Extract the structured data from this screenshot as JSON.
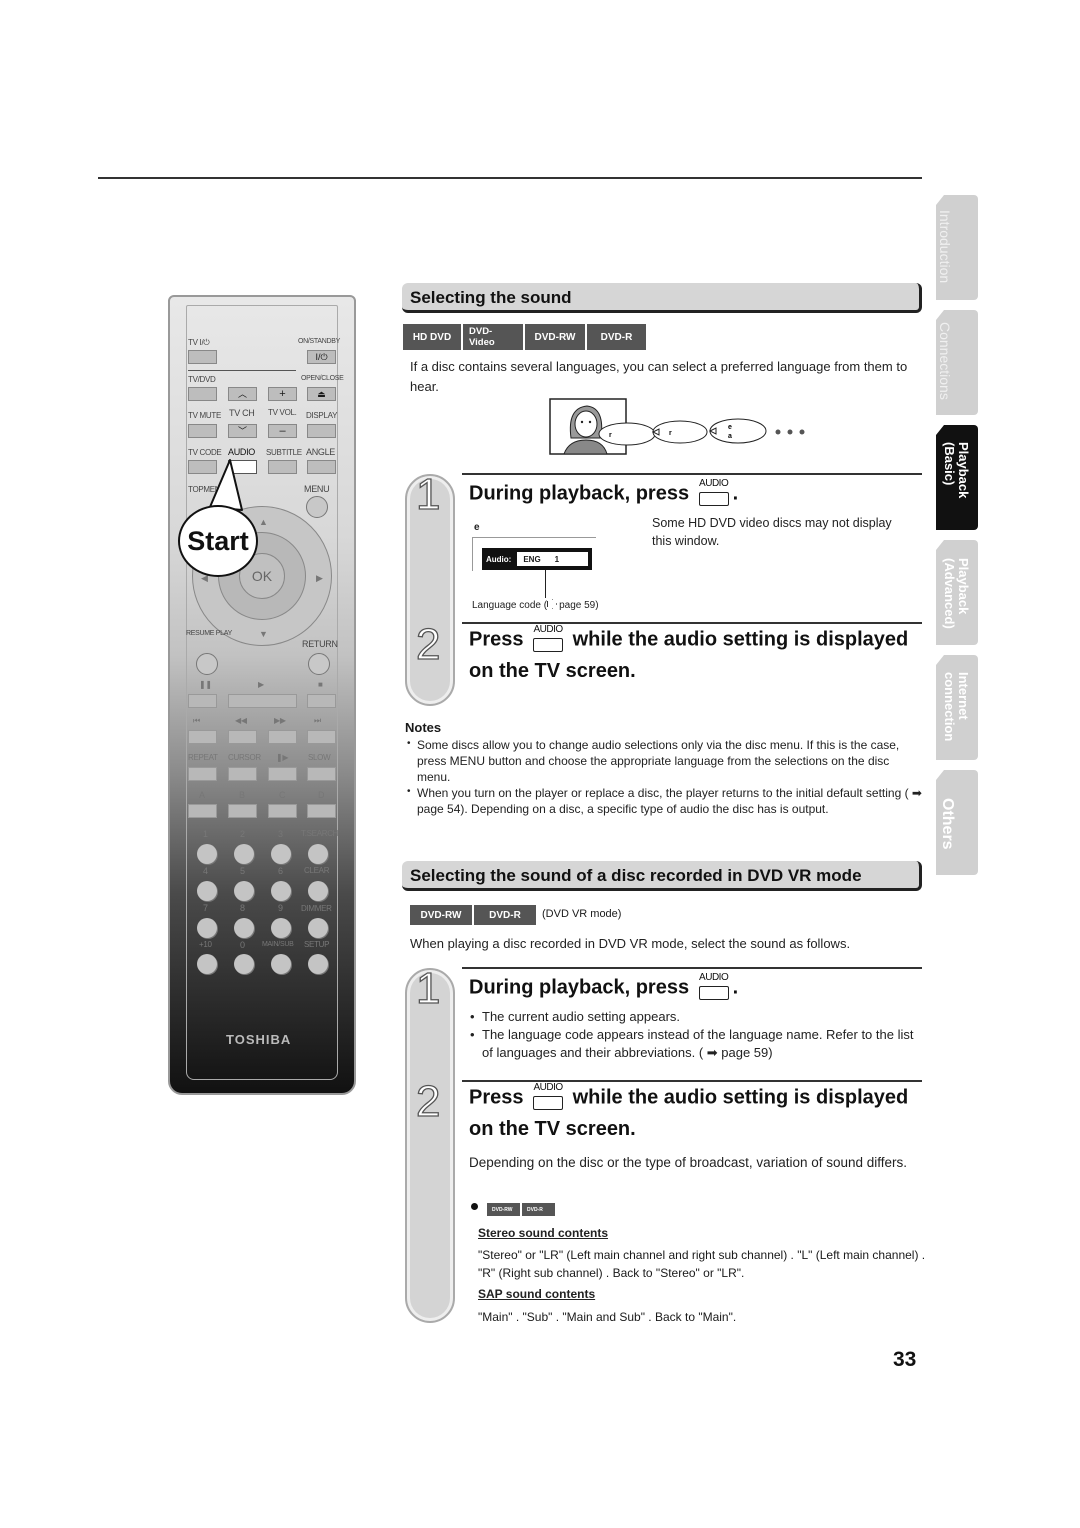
{
  "remote": {
    "labels": {
      "tv_power": "TV I/⏻",
      "on_standby": "ON/STANDBY",
      "power_glyph": "I/⏻",
      "tv_dvd": "TV/DVD",
      "open_close": "OPEN/CLOSE",
      "tv_mute": "TV MUTE",
      "tv_ch": "TV CH",
      "tv_vol": "TV VOL.",
      "display": "DISPLAY",
      "tv_code": "TV CODE",
      "audio": "AUDIO",
      "subtitle": "SUBTITLE",
      "angle": "ANGLE",
      "topmenu": "TOPMENU",
      "menu": "MENU",
      "ok": "OK",
      "resume_play": "RESUME PLAY",
      "return": "RETURN",
      "repeat": "REPEAT",
      "cursor": "CURSOR",
      "slow": "SLOW",
      "a": "A",
      "b": "B",
      "c": "C",
      "d": "D",
      "t_search": "T.SEARCH",
      "clear": "CLEAR",
      "dimmer": "DIMMER",
      "plus10": "+10",
      "main_sub": "MAIN/SUB",
      "setup": "SETUP",
      "brand": "TOSHIBA",
      "digits": [
        "1",
        "2",
        "3",
        "4",
        "5",
        "6",
        "7",
        "8",
        "9",
        "0"
      ]
    },
    "start_callout": "Start"
  },
  "section1": {
    "title": "Selecting the sound",
    "badges": [
      "HD DVD",
      "DVD-Video",
      "DVD-RW",
      "DVD-R"
    ],
    "intro": "If a disc contains several languages, you can select a preferred language from them to hear.",
    "bubbles": [
      "r",
      "r",
      "e a"
    ],
    "step1": {
      "number": "1",
      "title_pre": "During playback, press",
      "key_label": "AUDIO",
      "title_post": ".",
      "screen_label": "e",
      "osd_label": "Audio:",
      "osd_lang": "ENG",
      "osd_num": "1",
      "lang_code_note_pre": "Language code (",
      "lang_code_note_post": "page 59)",
      "side_note": "Some HD DVD video discs may not display this window."
    },
    "step2": {
      "number": "2",
      "title_pre": "Press",
      "key_label": "AUDIO",
      "title_post": "while the audio setting is displayed",
      "title_line2": "on the TV screen."
    },
    "notes": {
      "title": "Notes",
      "items": [
        "Some discs allow you to change audio selections only via the disc menu. If this is the case, press MENU button and choose the appropriate language from the selections on the disc menu.",
        "When you turn on the player or replace a disc, the player returns to the initial default setting ( ➡ page 54). Depending on a disc, a specific type of audio the disc has is output."
      ]
    }
  },
  "section2": {
    "title": "Selecting the sound of a disc recorded in DVD VR mode",
    "badges": [
      "DVD-RW",
      "DVD-R"
    ],
    "badge_note": "(DVD VR mode)",
    "intro": "When playing a disc recorded in DVD VR mode, select the sound as follows.",
    "step1": {
      "number": "1",
      "title_pre": "During playback, press",
      "key_label": "AUDIO",
      "title_post": ".",
      "bullets": [
        "The current audio setting appears.",
        "The language code appears instead of the language name. Refer to the list of languages and their abbreviations. ( ➡ page 59)"
      ]
    },
    "step2": {
      "number": "2",
      "title_pre": "Press",
      "key_label": "AUDIO",
      "title_post": "while the audio setting is displayed",
      "title_line2": "on the TV screen.",
      "desc": "Depending on the disc or the type of broadcast, variation of sound differs.",
      "mini_badges": [
        "DVD-RW",
        "DVD-R"
      ],
      "stereo_head": "Stereo sound contents",
      "stereo_text": "\"Stereo\" or \"LR\" (Left main channel and right sub channel) .   \"L\" (Left main channel) .   \"R\" (Right sub channel) .   Back to \"Stereo\" or \"LR\".",
      "sap_head": "SAP sound contents",
      "sap_text": "\"Main\" .   \"Sub\" .   \"Main and Sub\" .   Back to \"Main\"."
    }
  },
  "side_tabs": [
    {
      "label": "Introduction",
      "active": false
    },
    {
      "label": "Connections",
      "active": false
    },
    {
      "label": "Playback (Basic)",
      "active": true
    },
    {
      "label": "Playback (Advanced)",
      "active": false
    },
    {
      "label": "Internet connection",
      "active": false
    },
    {
      "label": "Others",
      "active": false
    }
  ],
  "page_number": "33"
}
